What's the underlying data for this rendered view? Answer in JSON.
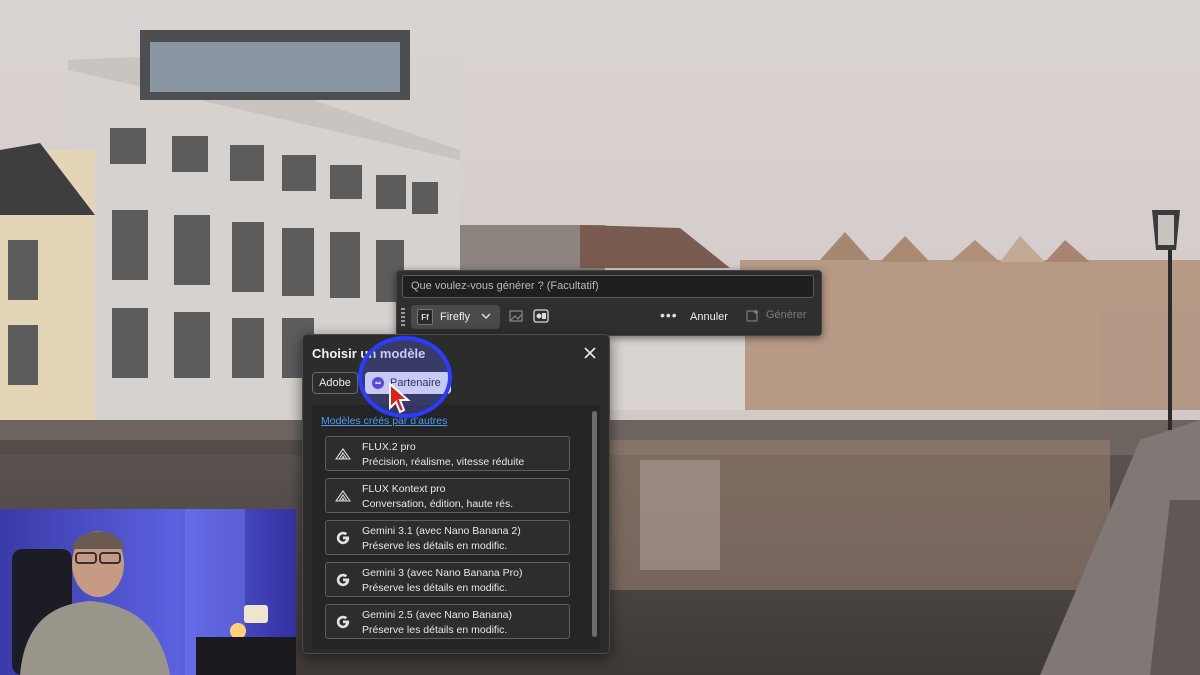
{
  "prompt_bar": {
    "placeholder": "Que voulez-vous générer ? (Facultatif)",
    "model_label": "Firefly",
    "model_badge": "Ff",
    "cancel_label": "Annuler",
    "generate_label": "Générer"
  },
  "model_panel": {
    "title": "Choisir un modèle",
    "tabs": [
      {
        "label": "Adobe",
        "selected": false
      },
      {
        "label": "Partenaire",
        "selected": true
      }
    ],
    "section_label": "Modèles créés par d'autres",
    "models": [
      {
        "name": "FLUX.2 pro",
        "description": "Précision, réalisme, vitesse réduite",
        "icon": "flux-icon"
      },
      {
        "name": "FLUX Kontext pro",
        "description": "Conversation, édition, haute rés.",
        "icon": "flux-icon"
      },
      {
        "name": "Gemini 3.1 (avec Nano Banana 2)",
        "description": "Préserve les détails en modific.",
        "icon": "google-icon"
      },
      {
        "name": "Gemini 3 (avec Nano Banana Pro)",
        "description": "Préserve les détails en modific.",
        "icon": "google-icon"
      },
      {
        "name": "Gemini 2.5 (avec Nano Banana)",
        "description": "Préserve les détails en modific.",
        "icon": "google-icon"
      }
    ]
  },
  "colors": {
    "accent_link": "#4b9bf0",
    "highlight_ring": "#2a3cff",
    "partner_icon": "#5a3ec9",
    "cursor": "#e0201b"
  }
}
